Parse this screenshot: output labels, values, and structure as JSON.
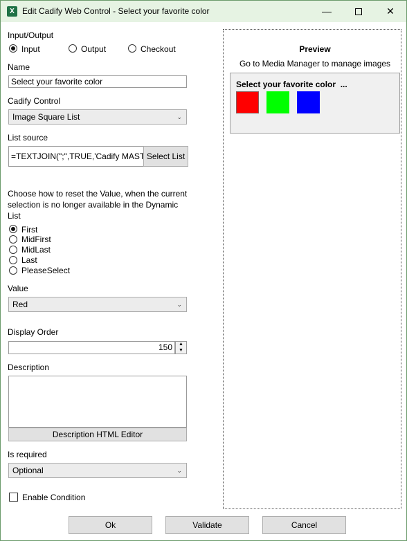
{
  "window": {
    "app_icon": "excel-icon",
    "title": "Edit Cadify Web Control - Select your favorite color",
    "minimize": "—",
    "close": "✕"
  },
  "io": {
    "label": "Input/Output",
    "options": [
      "Input",
      "Output",
      "Checkout"
    ],
    "selected": "Input"
  },
  "name": {
    "label": "Name",
    "value": "Select your favorite color"
  },
  "control": {
    "label": "Cadify Control",
    "value": "Image Square List"
  },
  "list_source": {
    "label": "List source",
    "value": "=TEXTJOIN(\";\",TRUE,'Cadify MASTER",
    "button": "Select List"
  },
  "reset": {
    "label": "Choose how to reset the Value, when the current selection is no longer available in the Dynamic List",
    "options": [
      "First",
      "MidFirst",
      "MidLast",
      "Last",
      "PleaseSelect"
    ],
    "selected": "First"
  },
  "value": {
    "label": "Value",
    "value": "Red"
  },
  "display_order": {
    "label": "Display Order",
    "value": "150"
  },
  "description": {
    "label": "Description",
    "value": "",
    "editor_button": "Description HTML Editor"
  },
  "required": {
    "label": "Is required",
    "value": "Optional"
  },
  "condition": {
    "label": "Enable Condition",
    "checked": false
  },
  "preview": {
    "heading": "Preview",
    "hint": "Go to Media Manager to manage images",
    "control_title": "Select your favorite color  ...",
    "swatches": [
      "#ff0000",
      "#00ff00",
      "#0000ff"
    ],
    "swatch_border": "#8b5a5a"
  },
  "buttons": {
    "ok": "Ok",
    "validate": "Validate",
    "cancel": "Cancel"
  }
}
